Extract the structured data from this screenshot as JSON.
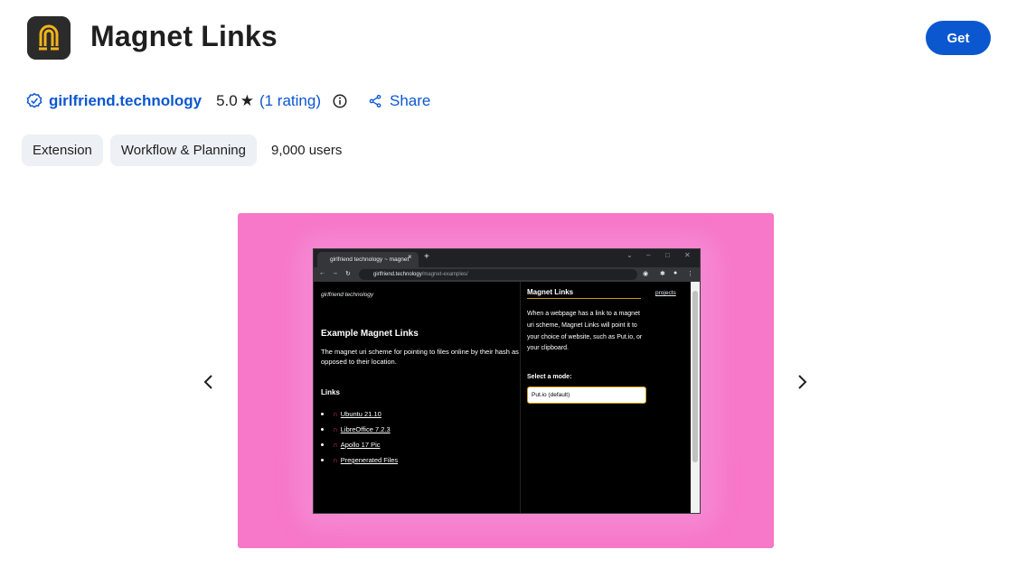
{
  "header": {
    "title": "Magnet Links",
    "get_label": "Get",
    "icon": "magnet-icon"
  },
  "meta": {
    "publisher": "girlfriend.technology",
    "rating": "5.0",
    "rating_count": "1 rating",
    "share_label": "Share"
  },
  "chips": [
    "Extension",
    "Workflow & Planning"
  ],
  "users": "9,000 users",
  "screenshot": {
    "tab_title": "girlfriend technology ~ magnet",
    "url_host": "girlfriend.technology",
    "url_path": "/magnet-examples/",
    "site_logo": "girlfriend technology",
    "heading": "Example Magnet Links",
    "description": "The magnet uri scheme for pointing to files online by their hash as opposed to their location.",
    "links_heading": "Links",
    "links": [
      "Ubuntu 21.10",
      "LibreOffice 7.2.3",
      "Apollo 17 Pic",
      "Pregenerated Files"
    ],
    "popup_title": "Magnet Links",
    "popup_text": "When a webpage has a link to a magnet uri scheme, Magnet Links will point it to your choice of website, such as Put.io, or your clipboard.",
    "popup_label": "Select a mode:",
    "popup_select": "Put.io (default)",
    "projects_link": "projects"
  },
  "colors": {
    "accent": "#0b57d0",
    "slide_bg": "#f777c9",
    "chip_bg": "#edf0f5"
  }
}
